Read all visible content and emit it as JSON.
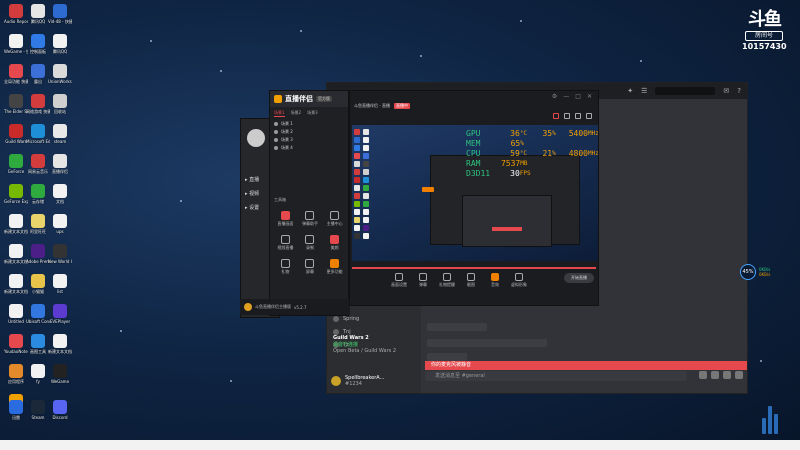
{
  "brand": {
    "logo_text": "斗鱼",
    "room_label": "房间号",
    "room_number": "10157430"
  },
  "desktop_icons": [
    {
      "label": "Audio Reposit...",
      "color": "#d23c3c"
    },
    {
      "label": "腾讯QQ",
      "color": "#e5e5e5"
    },
    {
      "label": "Vid-48 - 快捷方式",
      "color": "#2d6bd0"
    },
    {
      "label": "WeGame - 快捷方式",
      "color": "#f2f2f2"
    },
    {
      "label": "控制面板",
      "color": "#2f7ae5"
    },
    {
      "label": "腾讯QQ",
      "color": "#f2f2f2"
    },
    {
      "label": "全局功能 快捷方式",
      "color": "#e5484d"
    },
    {
      "label": "露出",
      "color": "#3c6fd8"
    },
    {
      "label": "UnionWorks 快捷方式",
      "color": "#dadada"
    },
    {
      "label": "The Elder Scrolls",
      "color": "#444"
    },
    {
      "label": "网络游戏 快捷方式",
      "color": "#d23c3c"
    },
    {
      "label": "回收站",
      "color": "#cfcfcf"
    },
    {
      "label": "Guild Wars",
      "color": "#c92a2a"
    },
    {
      "label": "Microsoft Edge",
      "color": "#1e8fd6"
    },
    {
      "label": "steam",
      "color": "#e8e8e8"
    },
    {
      "label": "GeForce",
      "color": "#2faa3f"
    },
    {
      "label": "网易云音乐",
      "color": "#d23c3c"
    },
    {
      "label": "直播伴侣",
      "color": "#e5e5e5"
    },
    {
      "label": "GeForce Experience",
      "color": "#76b900"
    },
    {
      "label": "云存储",
      "color": "#2faa3f"
    },
    {
      "label": "文档",
      "color": "#f2f2f2"
    },
    {
      "label": "新建文本文档",
      "color": "#f2f2f2"
    },
    {
      "label": "阿里旺旺",
      "color": "#e8d46a"
    },
    {
      "label": "ups",
      "color": "#f2f2f2"
    },
    {
      "label": "新建文本文档 (3)",
      "color": "#f2f2f2"
    },
    {
      "label": "Adobe Premie...",
      "color": "#4b1f87"
    },
    {
      "label": "New World Closed Beta",
      "color": "#333"
    },
    {
      "label": "新建文本文档 (2)",
      "color": "#f2f2f2"
    },
    {
      "label": "小猫猫",
      "color": "#e8c44a"
    },
    {
      "label": "list",
      "color": "#f2f2f2"
    },
    {
      "label": "Untitled",
      "color": "#f2f2f2"
    },
    {
      "label": "Ubisoft Connect",
      "color": "#3277e0"
    },
    {
      "label": "EVEPlayer",
      "color": "#5c3bd0"
    },
    {
      "label": "YoudaoNote 快捷方式",
      "color": "#e5484d"
    },
    {
      "label": "画图工具",
      "color": "#2b8be0"
    },
    {
      "label": "新建文本文档",
      "color": "#f2f2f2"
    },
    {
      "label": "应用程序",
      "color": "#e58a2b"
    },
    {
      "label": "fy",
      "color": "#f2f2f2"
    },
    {
      "label": "WeGame",
      "color": "#222"
    },
    {
      "label": "云游戏",
      "color": "#f0a000"
    },
    {
      "label": "迅雷",
      "color": "#2b6be0"
    },
    {
      "label": "Steam",
      "color": "#1b2838"
    },
    {
      "label": "Discord",
      "color": "#5865f2"
    }
  ],
  "streaming_tool": {
    "logo": "直播伴侣",
    "badge": "官方版",
    "tabs": [
      "场景1",
      "场景2",
      "场景3"
    ],
    "scenes": [
      "场景 1",
      "场景 2",
      "场景 3",
      "场景 4"
    ],
    "tools_label": "工具箱",
    "grid": [
      {
        "label": "直播画面",
        "type": "red"
      },
      {
        "label": "弹幕助手",
        "type": ""
      },
      {
        "label": "主播中心",
        "type": ""
      },
      {
        "label": "视频直播",
        "type": ""
      },
      {
        "label": "录制",
        "type": ""
      },
      {
        "label": "美颜",
        "type": "red"
      },
      {
        "label": "礼物",
        "type": ""
      },
      {
        "label": "屏幕",
        "type": ""
      },
      {
        "label": "更多功能",
        "type": "orange"
      }
    ],
    "footer_user": "斗鱼直播伴侣主播版",
    "footer_version": "v5.2.7"
  },
  "preview": {
    "title": "斗鱼直播伴侣 - 直播",
    "subtitle_tag": "直播中",
    "hud": [
      {
        "k": "GPU",
        "v1": "36",
        "u1": "°C",
        "v2": "35",
        "u2": "%",
        "v3": "5400",
        "u3": "MHz"
      },
      {
        "k": "MEM",
        "v1": "65",
        "u1": "%",
        "v2": "",
        "u2": "",
        "v3": "",
        "u3": ""
      },
      {
        "k": "CPU",
        "v1": "59",
        "u1": "°C",
        "v2": "21",
        "u2": "%",
        "v3": "4800",
        "u3": "MHz"
      },
      {
        "k": "RAM",
        "v1": "7537",
        "u1": "MB",
        "v2": "",
        "u2": "",
        "v3": "",
        "u3": ""
      },
      {
        "k": "D3D11",
        "v1": "30",
        "u1": "FPS",
        "v2": "",
        "u2": "",
        "v3": "",
        "u3": ""
      }
    ],
    "bottom_buttons": [
      "画面设置",
      "弹幕",
      "礼物提醒",
      "截图",
      "音效",
      "虚拟形象"
    ],
    "go_live": "开始直播",
    "progress": 1.0
  },
  "discord": {
    "channels": [
      "Spring",
      "Tnj",
      "Tz"
    ],
    "voice_status": "语音已连接",
    "voice_server": "Open Beta / Guild Wars 2",
    "server_name": "Guild Wars 2",
    "user_name": "SpellbreakerA...",
    "user_tag": "#1234",
    "banner": "你的麦克风被静音",
    "input_placeholder": "发送消息至 #general"
  },
  "network": {
    "percent": "45%",
    "up": "0KB/s",
    "down": "0KB/s"
  },
  "colors": {
    "accent_red": "#e5484d",
    "orange": "#f08000",
    "hud_green": "#2ec27e",
    "hud_orange": "#f3a000"
  }
}
